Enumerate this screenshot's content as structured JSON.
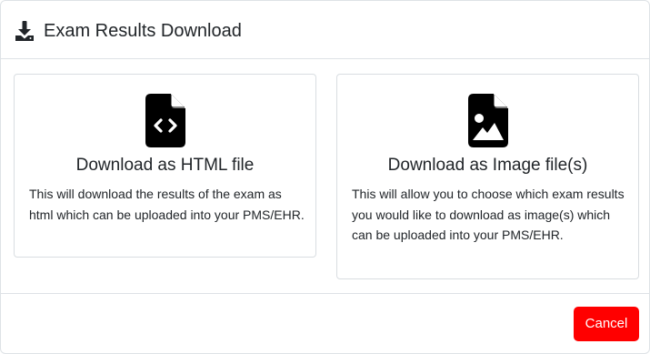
{
  "header": {
    "title": "Exam Results Download",
    "icon": "download-icon"
  },
  "options": [
    {
      "icon": "file-code-icon",
      "title": "Download as HTML file",
      "description": "This will download the results of the exam as html which can be uploaded into your PMS/EHR."
    },
    {
      "icon": "file-image-icon",
      "title": "Download as Image file(s)",
      "description": "This will allow you to choose which exam results you would like to download as image(s) which can be uploaded into your PMS/EHR."
    }
  ],
  "footer": {
    "cancel_label": "Cancel"
  },
  "colors": {
    "cancel_bg": "#ff0000",
    "icon": "#000000",
    "border": "#dee2e6"
  }
}
